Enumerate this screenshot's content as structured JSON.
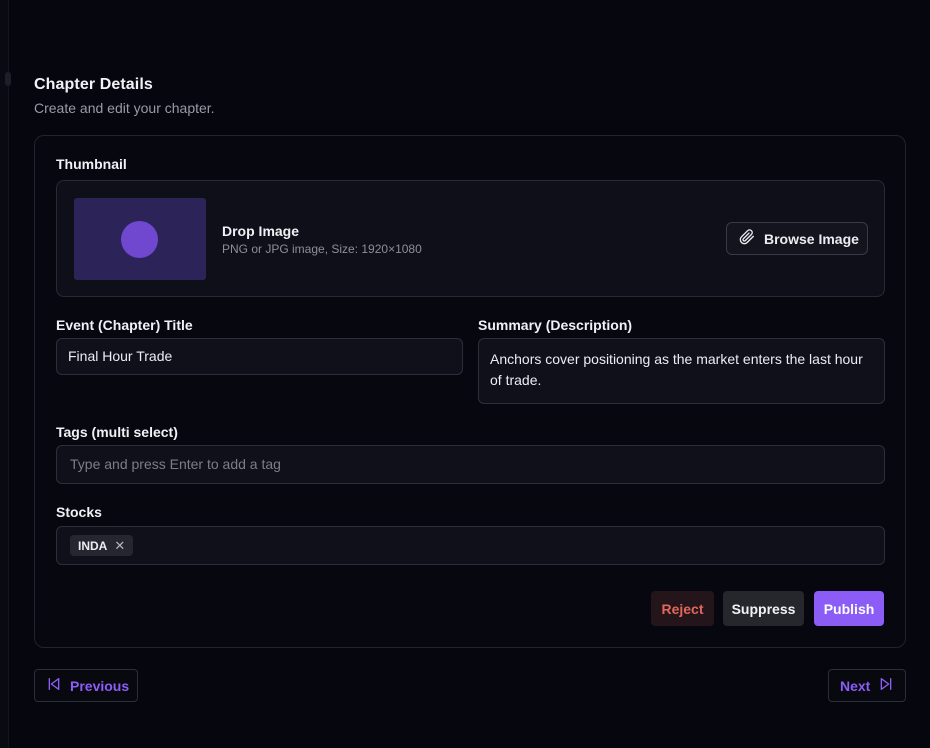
{
  "header": {
    "title": "Chapter Details",
    "subtitle": "Create and edit your chapter."
  },
  "thumbnail": {
    "label": "Thumbnail",
    "drop_title": "Drop Image",
    "drop_hint": "PNG or JPG image, Size: 1920×1080",
    "browse_label": "Browse Image",
    "browse_icon": "paperclip-icon",
    "preview_color": "#2c2459",
    "preview_accent": "#7048cf"
  },
  "form": {
    "title_label": "Event (Chapter) Title",
    "title_value": "Final Hour Trade",
    "summary_label": "Summary (Description)",
    "summary_value": "Anchors cover positioning as the market enters the last hour of trade.",
    "tags_label": "Tags (multi select)",
    "tags_placeholder": "Type and press Enter to add a tag",
    "stocks_label": "Stocks",
    "stocks": [
      {
        "label": "INDA",
        "remove_glyph": "✕"
      }
    ]
  },
  "actions": {
    "reject_label": "Reject",
    "suppress_label": "Suppress",
    "publish_label": "Publish"
  },
  "navigation": {
    "previous_label": "Previous",
    "next_label": "Next",
    "previous_icon": "skip-back-icon",
    "next_icon": "skip-forward-icon"
  },
  "colors": {
    "accent": "#8b5cf6",
    "reject": "#e0675e",
    "background": "#06060f"
  }
}
